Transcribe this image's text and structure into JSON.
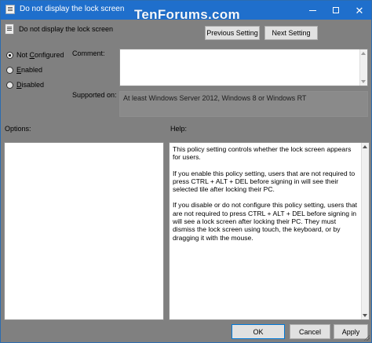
{
  "window": {
    "title": "Do not display the lock screen",
    "watermark": "TenForums.com",
    "controls": {
      "minimize": "—",
      "maximize": "☐",
      "close": "✕"
    }
  },
  "policy": {
    "name": "Do not display the lock screen"
  },
  "nav": {
    "previous_label": "Previous Setting",
    "next_label": "Next Setting"
  },
  "state": {
    "options": [
      {
        "key": "not_configured",
        "prefix": "Not ",
        "accel": "C",
        "suffix": "onfigured",
        "checked": true
      },
      {
        "key": "enabled",
        "prefix": "",
        "accel": "E",
        "suffix": "nabled",
        "checked": false
      },
      {
        "key": "disabled",
        "prefix": "",
        "accel": "D",
        "suffix": "isabled",
        "checked": false
      }
    ]
  },
  "labels": {
    "comment": "Comment:",
    "supported_on": "Supported on:",
    "options": "Options:",
    "help": "Help:"
  },
  "supported_on_value": "At least Windows Server 2012, Windows 8 or Windows RT",
  "help_text": [
    "This policy setting controls whether the lock screen appears for users.",
    "If you enable this policy setting, users that are not required to press CTRL + ALT + DEL before signing in will see their selected tile after locking their PC.",
    "If you disable or do not configure this policy setting, users that are not required to press CTRL + ALT + DEL before signing in will see a lock screen after locking their PC. They must dismiss the lock screen using touch, the keyboard, or by dragging it with the mouse."
  ],
  "footer": {
    "ok_label": "OK",
    "cancel_label": "Cancel",
    "apply_label": "Apply"
  },
  "colors": {
    "titlebar": "#1f6fcc",
    "dialog_bg": "#808080",
    "focus_border": "#0078d7"
  }
}
